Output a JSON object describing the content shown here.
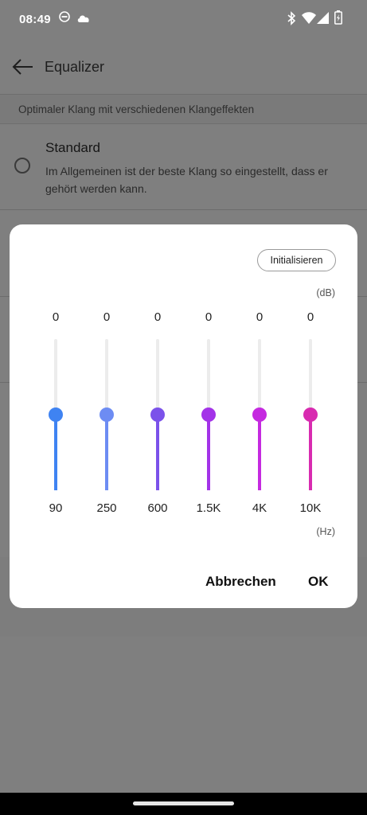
{
  "status_bar": {
    "time": "08:49",
    "icons": [
      "do-not-disturb-icon",
      "cloud-icon",
      "bluetooth-icon",
      "wifi-icon",
      "signal-icon",
      "battery-icon"
    ]
  },
  "app_bar": {
    "title": "Equalizer",
    "back_icon": "back-arrow-icon"
  },
  "subtitle": "Optimaler Klang mit verschiedenen Klangeffekten",
  "option": {
    "title": "Standard",
    "description": "Im Allgemeinen ist der beste Klang so eingestellt, dass er gehört werden kann.",
    "selected": false
  },
  "dialog": {
    "init_button": "Initialisieren",
    "db_unit": "(dB)",
    "hz_unit": "(Hz)",
    "cancel_button": "Abbrechen",
    "ok_button": "OK",
    "range_db": [
      -12,
      12
    ],
    "bands": [
      {
        "value": "0",
        "freq": "90",
        "color": "#3f83f2"
      },
      {
        "value": "0",
        "freq": "250",
        "color": "#6d8cf3"
      },
      {
        "value": "0",
        "freq": "600",
        "color": "#7b52ea"
      },
      {
        "value": "0",
        "freq": "1.5K",
        "color": "#a333e8"
      },
      {
        "value": "0",
        "freq": "4K",
        "color": "#c52ae0"
      },
      {
        "value": "0",
        "freq": "10K",
        "color": "#d82bb0"
      }
    ]
  },
  "colors": {
    "scrim": "#7f7f7f",
    "dialog_bg": "#ffffff",
    "track": "#ececec"
  }
}
